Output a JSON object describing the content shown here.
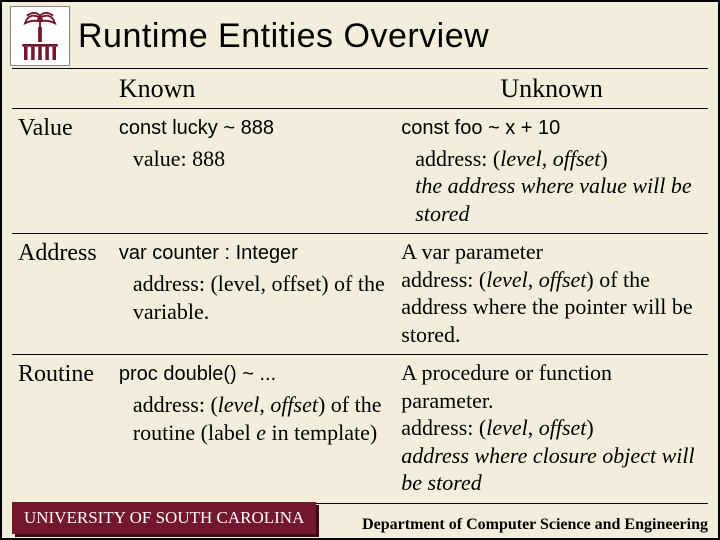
{
  "title": "Runtime Entities Overview",
  "columns": {
    "known": "Known",
    "unknown": "Unknown"
  },
  "rows": {
    "value": {
      "label": "Value",
      "known_code": "const lucky ~ 888",
      "known_body": "value: 888",
      "unknown_code": "const foo ~ x + 10",
      "unknown_body": "address: (level, offset) the address where value will be stored"
    },
    "address": {
      "label": "Address",
      "known_code": "var counter : Integer",
      "known_body": "address: (level, offset) of the variable.",
      "unknown_body": "A var parameter address: (level, offset) of the address where the pointer will be stored."
    },
    "routine": {
      "label": "Routine",
      "known_code": "proc double() ~ ...",
      "known_body": "address: (level, offset) of the routine (label e in template)",
      "unknown_body": "A procedure or function parameter. address: (level, offset) address where closure object will be stored"
    }
  },
  "footer": {
    "left": "UNIVERSITY OF SOUTH CAROLINA",
    "right": "Department of Computer Science and Engineering"
  }
}
